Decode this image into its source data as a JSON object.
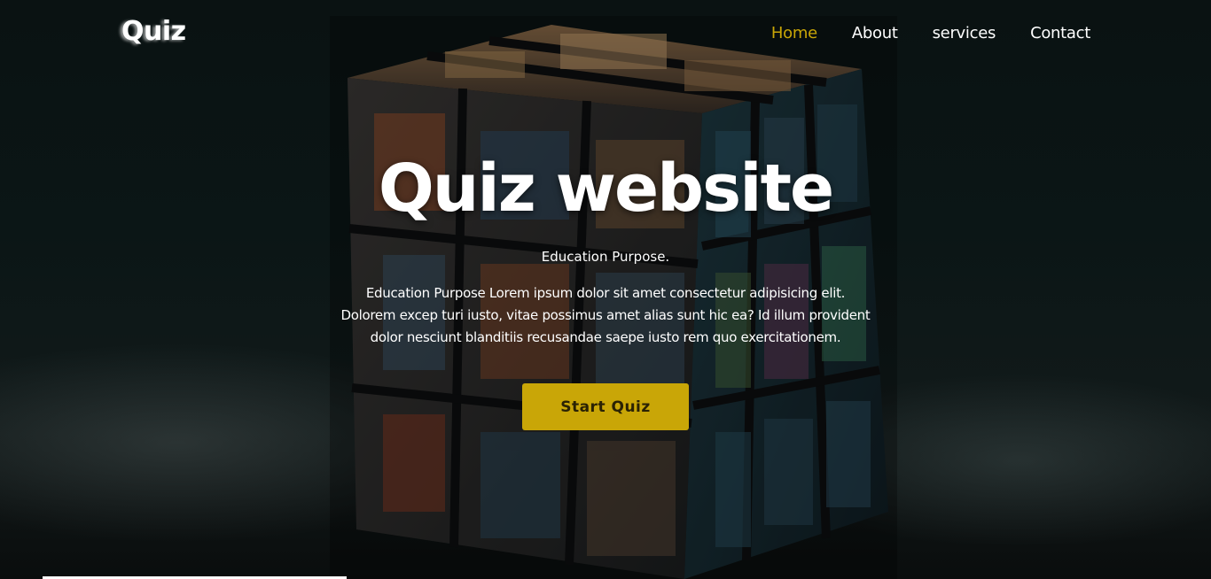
{
  "brand": {
    "logo": "Quiz"
  },
  "nav": {
    "items": [
      {
        "label": "Home",
        "active": true
      },
      {
        "label": "About",
        "active": false
      },
      {
        "label": "services",
        "active": false
      },
      {
        "label": "Contact",
        "active": false
      }
    ]
  },
  "hero": {
    "title": "Quiz website",
    "subtitle": "Education Purpose.",
    "description": "Education Purpose Lorem ipsum dolor sit amet consectetur adipisicing elit. Dolorem excep turi iusto, vitae possimus amet alias sunt hic ea? Id illum provident dolor nesciunt blanditiis recusandae saepe iusto rem quo exercitationem.",
    "button_label": "Start Quiz"
  },
  "colors": {
    "accent": "#c9a607",
    "text": "#ffffff",
    "background": "#0b1414"
  },
  "icons": {
    "hero_image": "rubiks-cube-image"
  }
}
